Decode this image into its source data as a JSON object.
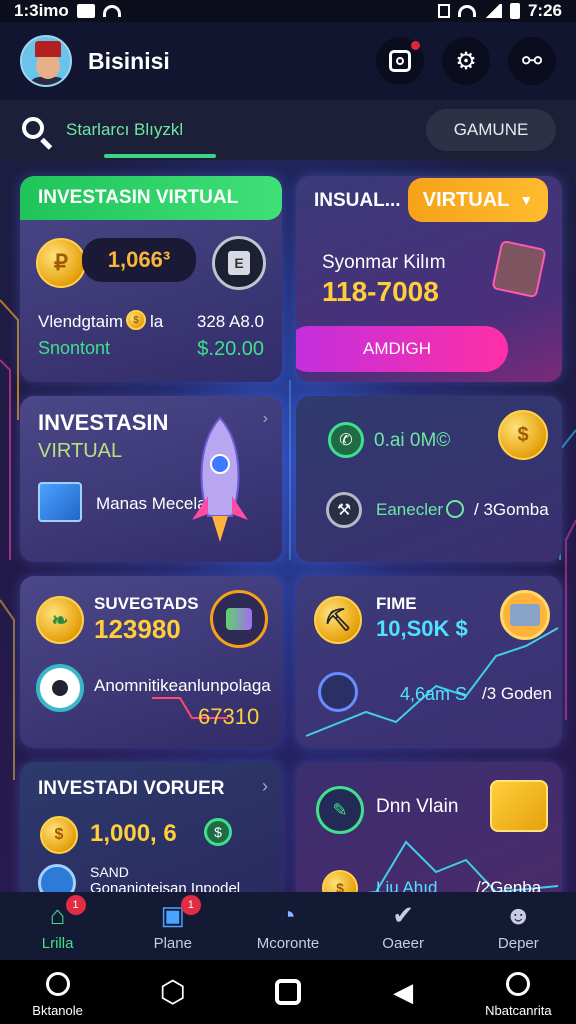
{
  "status_bar": {
    "left_text": "1:3imo",
    "time": "7:26"
  },
  "header": {
    "title": "Bisinisi",
    "icons": [
      "camera-icon",
      "gear-icon",
      "share-icon"
    ]
  },
  "search": {
    "placeholder": "Starlarcı Blıyzkl",
    "button_label": "GAMUNE"
  },
  "cards": {
    "card1": {
      "tab_label": "INVESTASIN VIRTUAL",
      "balance": "1,066³",
      "row1_label": "Vlendgtaim",
      "row1_suffix": "la",
      "row1_value": "328 A8.0",
      "row2_label": "Snontont",
      "row2_value": "$.20.00"
    },
    "card2": {
      "title": "INSUAL...",
      "dropdown_label": "VIRTUAL",
      "subtitle": "Syonmar Kilım",
      "value": "118-7008",
      "button_label": "AMDIGH"
    },
    "card3": {
      "title": "INVESTASIN",
      "subtitle": "VIRTUAL",
      "label": "Manas Mecelan"
    },
    "card4": {
      "row1": "0.ai 0M©",
      "row2_label": "Eanecler",
      "row2_value": "/ 3Gomba"
    },
    "card5": {
      "title": "SUVEGTADS",
      "value": "123980",
      "label": "Anomnitikeanlunpolaga",
      "sub_value": "67310"
    },
    "card6": {
      "title": "FIME",
      "value": "10,S0K $",
      "row_value": "4,6am S",
      "row_label": "/3 Goden"
    },
    "card7": {
      "title": "INVESTADI VORUER",
      "value": "1,000, 6",
      "small_label": "SAND",
      "sub_label": "Gonanioteisan Inpodel"
    },
    "card8": {
      "label": "Dnn Vlain",
      "row_value": "Liu Ahıd",
      "row_label": "/2Genba"
    }
  },
  "bottom_nav": [
    {
      "label": "Lrilla",
      "icon": "home-icon",
      "active": true,
      "badge": "1"
    },
    {
      "label": "Plane",
      "icon": "wallet-icon",
      "active": false,
      "badge": "1"
    },
    {
      "label": "Mcoronte",
      "icon": "chart-icon",
      "active": false
    },
    {
      "label": "Oaeer",
      "icon": "check-icon",
      "active": false
    },
    {
      "label": "Deper",
      "icon": "user-icon",
      "active": false
    }
  ],
  "system_nav": {
    "left_label": "Bktanole",
    "right_label": "Nbatcanrita"
  },
  "colors": {
    "accent_green": "#3fe08b",
    "accent_orange": "#f6a219",
    "accent_pink": "#ff2fa6",
    "gold": "#f7b63b"
  }
}
